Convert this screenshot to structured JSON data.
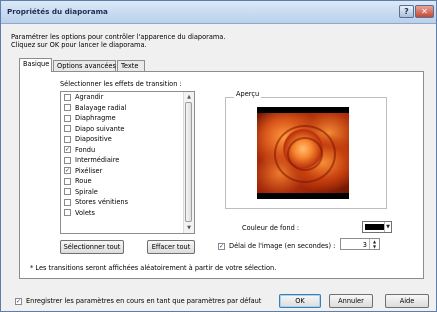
{
  "window": {
    "title": "Propriétés du diaporama",
    "help_glyph": "?",
    "close_glyph": "✕"
  },
  "description": {
    "line1": "Paramétrer les options pour contrôler l'apparence du diaporama.",
    "line2": "Cliquez sur OK pour lancer le diaporama."
  },
  "tabs": [
    {
      "label": "Basique",
      "active": true
    },
    {
      "label": "Options avancées",
      "active": false
    },
    {
      "label": "Texte",
      "active": false
    }
  ],
  "basic": {
    "effects_label": "Sélectionner les effets de transition :",
    "transitions": [
      {
        "label": "Agrandir",
        "checked": false
      },
      {
        "label": "Balayage radial",
        "checked": false
      },
      {
        "label": "Diaphragme",
        "checked": false
      },
      {
        "label": "Diapo suivante",
        "checked": false
      },
      {
        "label": "Diapositive",
        "checked": false
      },
      {
        "label": "Fondu",
        "checked": true
      },
      {
        "label": "Intermédiaire",
        "checked": false
      },
      {
        "label": "Pixéliser",
        "checked": true
      },
      {
        "label": "Roue",
        "checked": false
      },
      {
        "label": "Spirale",
        "checked": false
      },
      {
        "label": "Stores vénitiens",
        "checked": false
      },
      {
        "label": "Volets",
        "checked": false
      }
    ],
    "select_all_label": "Sélectionner tout",
    "clear_all_label": "Effacer tout",
    "preview_label": "Aperçu",
    "bg_color_label": "Couleur de fond :",
    "bg_color_value": "#000000",
    "delay_label": "Délai de l'image (en secondes) :",
    "delay_checked": true,
    "delay_value": "3",
    "note": "* Les transitions seront affichées aléatoirement à partir de votre sélection."
  },
  "footer": {
    "save_defaults_label": "Enregistrer les paramètres en cours en tant que paramètres par défaut",
    "save_defaults_checked": true,
    "ok_label": "OK",
    "cancel_label": "Annuler",
    "help_label": "Aide"
  },
  "check_glyph": "✓"
}
